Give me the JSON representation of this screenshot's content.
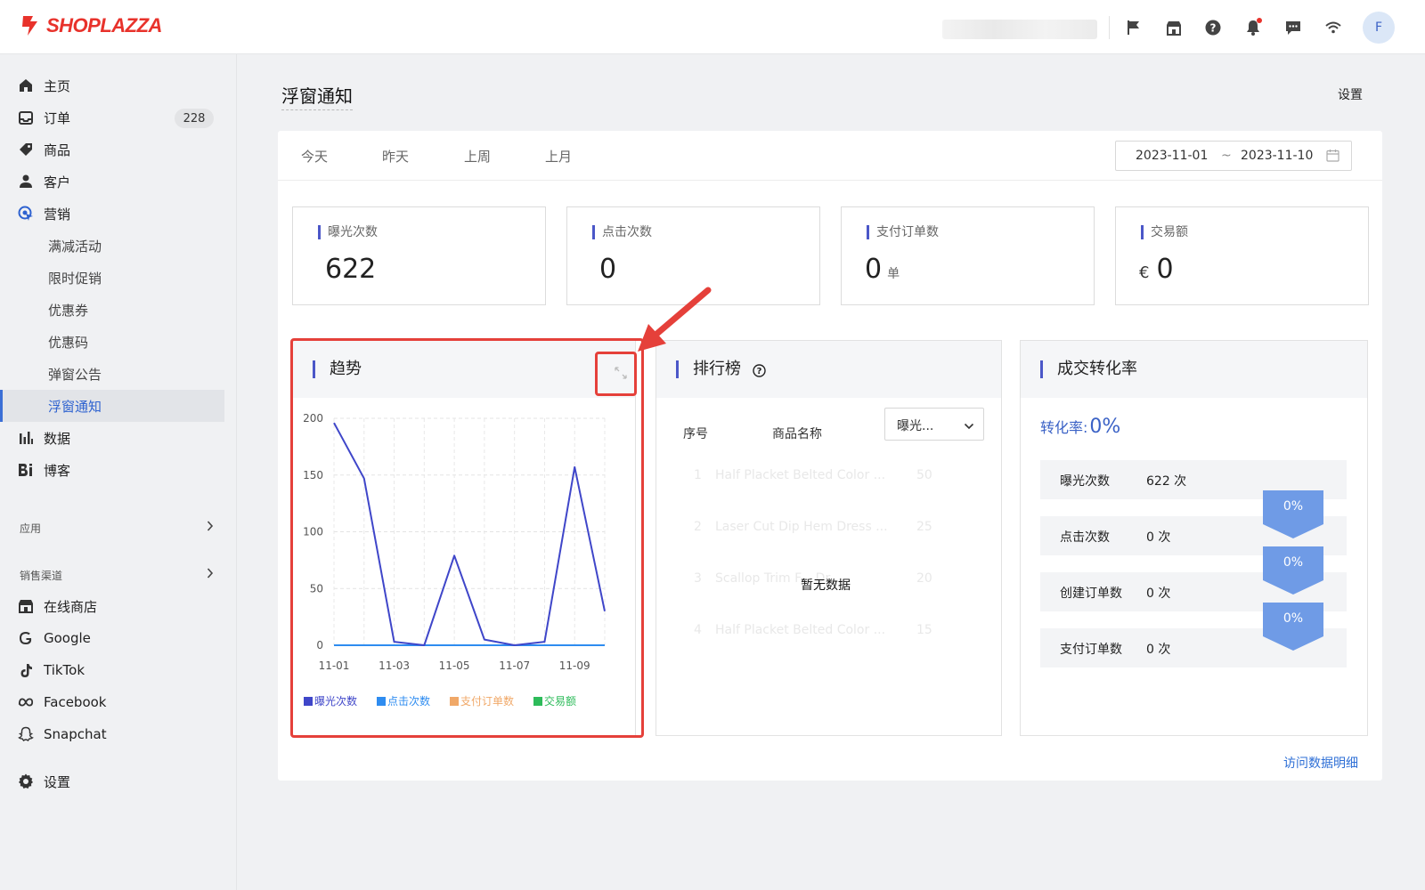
{
  "brand": {
    "name": "SHOPLAZZA",
    "color": "#e8322b"
  },
  "topbar": {
    "icons": [
      "flag-icon",
      "store-icon",
      "help-icon",
      "bell-icon",
      "message-icon",
      "wifi-icon"
    ],
    "avatar_initial": "F"
  },
  "sidebar": {
    "items": [
      {
        "label": "主页",
        "icon": "home-icon"
      },
      {
        "label": "订单",
        "icon": "inbox-icon",
        "badge": "228"
      },
      {
        "label": "商品",
        "icon": "tag-icon"
      },
      {
        "label": "客户",
        "icon": "person-icon"
      },
      {
        "label": "营销",
        "icon": "marketing-icon"
      },
      {
        "label": "满减活动"
      },
      {
        "label": "限时促销"
      },
      {
        "label": "优惠券"
      },
      {
        "label": "优惠码"
      },
      {
        "label": "弹窗公告"
      },
      {
        "label": "浮窗通知",
        "active": true
      },
      {
        "label": "数据",
        "icon": "bar-chart-icon"
      },
      {
        "label": "博客",
        "icon": "blog-icon"
      }
    ],
    "apps_section": "应用",
    "channels_section": "销售渠道",
    "channels": [
      {
        "label": "在线商店",
        "icon": "store-icon"
      },
      {
        "label": "Google",
        "icon": "google-icon"
      },
      {
        "label": "TikTok",
        "icon": "tiktok-icon"
      },
      {
        "label": "Facebook",
        "icon": "meta-icon"
      },
      {
        "label": "Snapchat",
        "icon": "snapchat-icon"
      }
    ],
    "settings": {
      "label": "设置",
      "icon": "gear-icon"
    }
  },
  "page": {
    "title": "浮窗通知",
    "settings_link": "设置"
  },
  "filters": {
    "tabs": [
      "今天",
      "昨天",
      "上周",
      "上月"
    ],
    "date_start": "2023-11-01",
    "date_sep": "~",
    "date_end": "2023-11-10"
  },
  "stats": [
    {
      "title": "曝光次数",
      "value": "622"
    },
    {
      "title": "点击次数",
      "value": "0"
    },
    {
      "title": "支付订单数",
      "value": "0",
      "unit": "单"
    },
    {
      "title": "交易额",
      "value": "0",
      "currency": "€"
    }
  ],
  "trend": {
    "title": "趋势",
    "legend": [
      "曝光次数",
      "点击次数",
      "支付订单数",
      "交易额"
    ]
  },
  "chart_data": {
    "type": "line",
    "title": "趋势",
    "x": [
      "11-01",
      "11-02",
      "11-03",
      "11-04",
      "11-05",
      "11-06",
      "11-07",
      "11-08",
      "11-09",
      "11-10"
    ],
    "x_tick_labels": [
      "11-01",
      "11-03",
      "11-05",
      "11-07",
      "11-09"
    ],
    "ylim": [
      0,
      200
    ],
    "yticks": [
      0,
      50,
      100,
      150,
      200
    ],
    "grid": true,
    "legend_placement": "bottom",
    "series": [
      {
        "name": "曝光次数",
        "color": "#3f46c9",
        "values": [
          196,
          147,
          3,
          0,
          79,
          5,
          0,
          3,
          157,
          30
        ]
      },
      {
        "name": "点击次数",
        "color": "#2e8cf0",
        "values": [
          0,
          0,
          0,
          0,
          0,
          0,
          0,
          0,
          0,
          0
        ]
      },
      {
        "name": "支付订单数",
        "color": "#f0a868",
        "values": [
          0,
          0,
          0,
          0,
          0,
          0,
          0,
          0,
          0,
          0
        ]
      },
      {
        "name": "交易额",
        "color": "#2dbb5a",
        "values": [
          0,
          0,
          0,
          0,
          0,
          0,
          0,
          0,
          0,
          0
        ]
      }
    ]
  },
  "ranking": {
    "title": "排行榜",
    "col_index": "序号",
    "col_name": "商品名称",
    "select_value": "曝光...",
    "empty_text": "暂无数据",
    "ghost_rows": [
      {
        "n": "1",
        "name": "Half Placket Belted Color ...",
        "num": "50"
      },
      {
        "n": "2",
        "name": "Laser Cut Dip Hem Dress ...",
        "num": "25"
      },
      {
        "n": "3",
        "name": "Scallop Trim F...           Dr...",
        "num": "20"
      },
      {
        "n": "4",
        "name": "Half Placket Belted Color ...",
        "num": "15"
      }
    ]
  },
  "conversion": {
    "title": "成交转化率",
    "rate_label": "转化率:",
    "rate_value": "0%",
    "rows": [
      {
        "label": "曝光次数",
        "value": "622 次"
      },
      {
        "label": "点击次数",
        "value": "0 次"
      },
      {
        "label": "创建订单数",
        "value": "0 次"
      },
      {
        "label": "支付订单数",
        "value": "0 次"
      }
    ],
    "step_rates": [
      "0%",
      "0%",
      "0%"
    ]
  },
  "footer_link": "访问数据明细",
  "colors": {
    "accent": "#4b57c8",
    "link": "#2e6fd6",
    "highlight": "#e5403a"
  }
}
